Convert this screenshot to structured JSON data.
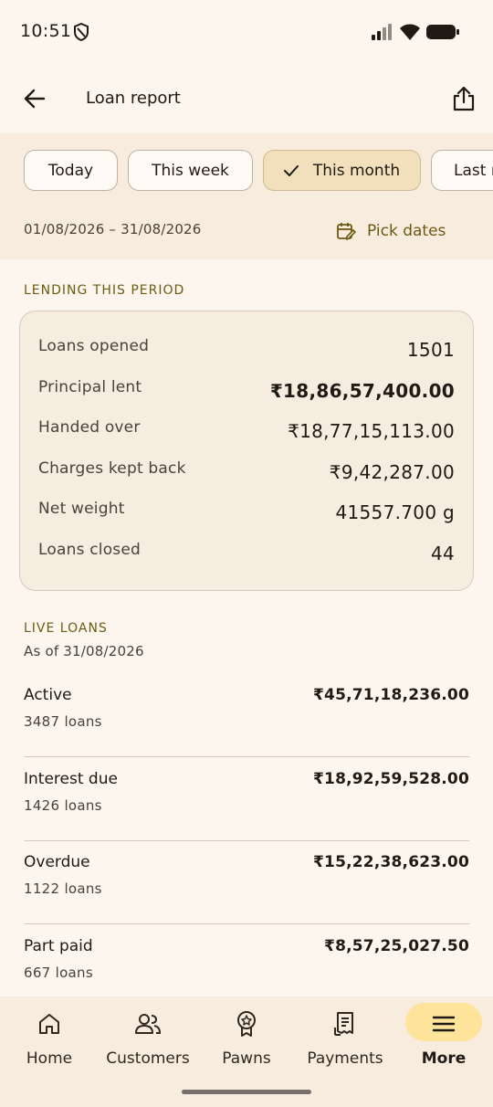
{
  "status_bar": {
    "time": "10:51"
  },
  "app_bar": {
    "title": "Loan report"
  },
  "filters": {
    "chips": [
      {
        "label": "Today",
        "selected": false
      },
      {
        "label": "This week",
        "selected": false
      },
      {
        "label": "This month",
        "selected": true
      },
      {
        "label": "Last m",
        "selected": false
      }
    ],
    "date_range": "01/08/2026 – 31/08/2026",
    "pick_dates_label": "Pick dates"
  },
  "lending": {
    "header": "LENDING THIS PERIOD",
    "rows": [
      {
        "label": "Loans opened",
        "value": "1501"
      },
      {
        "label": "Principal lent",
        "value": "₹18,86,57,400.00"
      },
      {
        "label": "Handed over",
        "value": "₹18,77,15,113.00"
      },
      {
        "label": "Charges kept back",
        "value": "₹9,42,287.00"
      },
      {
        "label": "Net weight",
        "value": "41557.700 g"
      },
      {
        "label": "Loans closed",
        "value": "44"
      }
    ]
  },
  "live_loans": {
    "header": "LIVE LOANS",
    "as_of": "As of 31/08/2026",
    "items": [
      {
        "label": "Active",
        "count": "3487 loans",
        "amount": "₹45,71,18,236.00"
      },
      {
        "label": "Interest due",
        "count": "1426 loans",
        "amount": "₹18,92,59,528.00"
      },
      {
        "label": "Overdue",
        "count": "1122 loans",
        "amount": "₹15,22,38,623.00"
      },
      {
        "label": "Part paid",
        "count": "667 loans",
        "amount": "₹8,57,25,027.50"
      }
    ]
  },
  "bottom_nav": {
    "items": [
      {
        "label": "Home",
        "icon": "home-icon"
      },
      {
        "label": "Customers",
        "icon": "people-icon"
      },
      {
        "label": "Pawns",
        "icon": "badge-icon"
      },
      {
        "label": "Payments",
        "icon": "receipt-icon"
      },
      {
        "label": "More",
        "icon": "menu-icon",
        "active": true
      }
    ]
  },
  "colors": {
    "background": "#fdf6ef",
    "panel": "#f8ecdf",
    "accent_text": "#6d5b12",
    "selected_chip": "#f2dfbb",
    "active_nav_pill": "#fde49a"
  }
}
